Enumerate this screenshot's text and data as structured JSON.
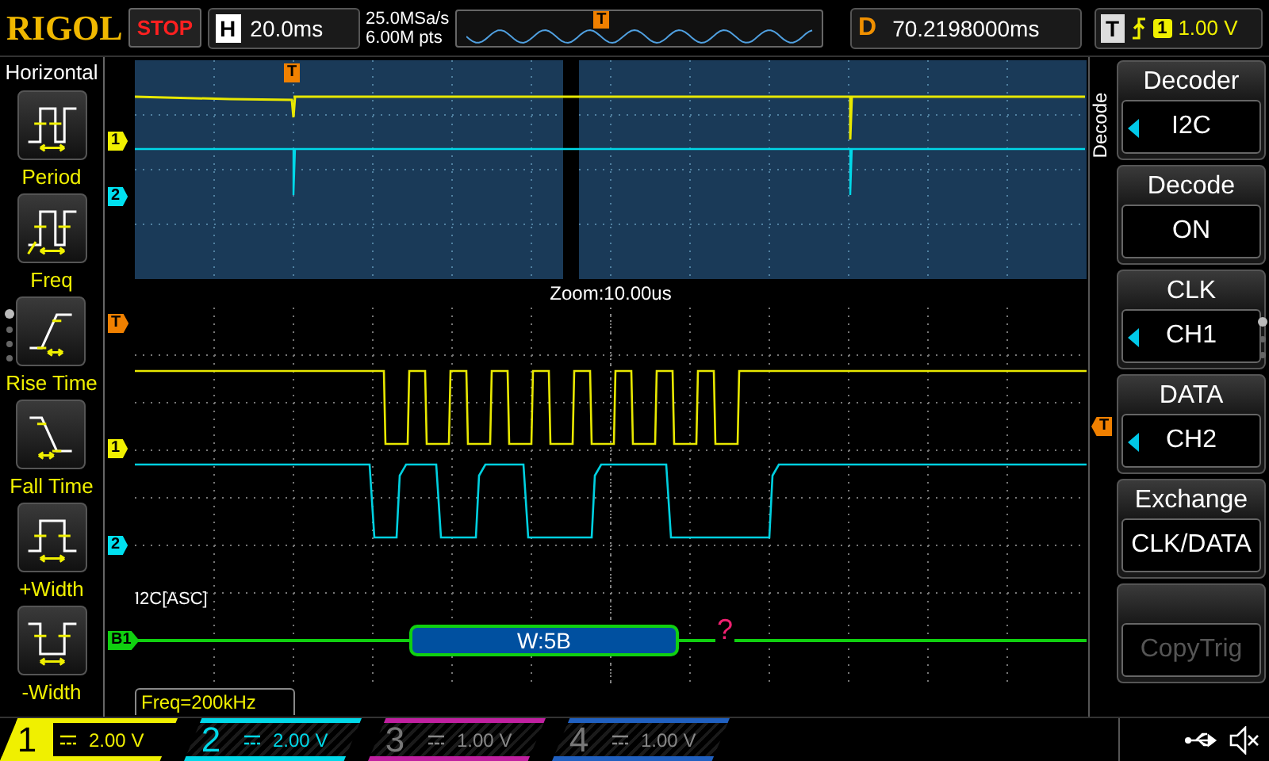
{
  "header": {
    "brand": "RIGOL",
    "run_state": "STOP",
    "timebase": {
      "label": "H",
      "value": "20.0ms"
    },
    "sample_rate": "25.0MSa/s",
    "memory_depth": "6.00M pts",
    "memory_marker": "T",
    "delay": {
      "label": "D",
      "value": "70.2198000ms"
    },
    "trigger": {
      "label": "T",
      "source": "1",
      "level": "1.00 V"
    }
  },
  "side_menu": {
    "title": "Horizontal",
    "items": [
      {
        "label": "Period",
        "kind": "period"
      },
      {
        "label": "Freq",
        "kind": "freq"
      },
      {
        "label": "Rise Time",
        "kind": "rise"
      },
      {
        "label": "Fall Time",
        "kind": "fall"
      },
      {
        "label": "+Width",
        "kind": "pos_width"
      },
      {
        "label": "-Width",
        "kind": "neg_width"
      }
    ]
  },
  "overview": {
    "trigger_marker": "T",
    "channel_markers": [
      {
        "text": "1",
        "color": "#f0f000"
      },
      {
        "text": "2",
        "color": "#00e0f0"
      }
    ],
    "zoom_label": "Zoom:10.00us"
  },
  "main": {
    "trigger_marker": "T",
    "channel_markers": [
      {
        "text": "1",
        "color": "#f0f000"
      },
      {
        "text": "2",
        "color": "#00e0f0"
      },
      {
        "text": "B1",
        "color": "#10d010"
      }
    ],
    "trigger_level_marker": "T",
    "bus_label": "I2C[ASC]",
    "packets": [
      {
        "text": "W:5B"
      }
    ],
    "error_mark": "?",
    "frequency": "Freq=200kHz"
  },
  "softkeys": {
    "title": "Decode",
    "items": [
      {
        "title": "Decoder",
        "value": "I2C",
        "arrow": true,
        "disabled": false
      },
      {
        "title": "Decode",
        "value": "ON",
        "arrow": false,
        "disabled": false
      },
      {
        "title": "CLK",
        "value": "CH1",
        "arrow": true,
        "disabled": false
      },
      {
        "title": "DATA",
        "value": "CH2",
        "arrow": true,
        "disabled": false
      },
      {
        "title": "Exchange",
        "value": "CLK/DATA",
        "arrow": false,
        "disabled": false
      },
      {
        "value": "CopyTrig",
        "arrow": false,
        "disabled": true
      }
    ]
  },
  "channels": [
    {
      "number": "1",
      "scale": "2.00 V",
      "selected": true,
      "enabled": true,
      "color": "#f0f000"
    },
    {
      "number": "2",
      "scale": "2.00 V",
      "selected": false,
      "enabled": true,
      "color": "#00d8e8"
    },
    {
      "number": "3",
      "scale": "1.00 V",
      "selected": false,
      "enabled": false,
      "color": "#c020a0"
    },
    {
      "number": "4",
      "scale": "1.00 V",
      "selected": false,
      "enabled": false,
      "color": "#2060c0"
    }
  ]
}
